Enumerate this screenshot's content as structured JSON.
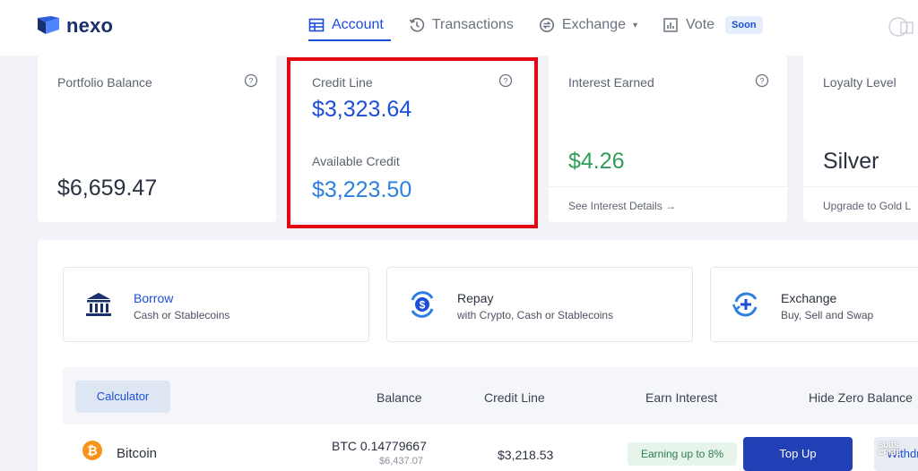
{
  "brand": {
    "name": "nexo"
  },
  "nav": {
    "items": [
      {
        "label": "Account",
        "icon": "table-icon",
        "active": true
      },
      {
        "label": "Transactions",
        "icon": "history-icon",
        "active": false
      },
      {
        "label": "Exchange",
        "icon": "exchange-icon",
        "active": false,
        "dropdown": true
      },
      {
        "label": "Vote",
        "icon": "chart-icon",
        "active": false,
        "badge": "Soon"
      }
    ],
    "gift_icon": "gift-icon"
  },
  "stats": {
    "portfolio": {
      "label": "Portfolio Balance",
      "value": "$6,659.47"
    },
    "credit": {
      "label": "Credit Line",
      "value": "$3,323.64",
      "available_label": "Available Credit",
      "available_value": "$3,223.50"
    },
    "interest": {
      "label": "Interest Earned",
      "value": "$4.26",
      "link": "See Interest Details →"
    },
    "loyalty": {
      "label": "Loyalty Level",
      "value": "Silver",
      "link": "Upgrade to Gold L"
    }
  },
  "actions": [
    {
      "title": "Borrow",
      "subtitle": "Cash or Stablecoins",
      "icon": "bank-icon"
    },
    {
      "title": "Repay",
      "subtitle": "with Crypto, Cash or Stablecoins",
      "icon": "repay-icon"
    },
    {
      "title": "Exchange",
      "subtitle": "Buy, Sell and Swap",
      "icon": "swap-icon"
    }
  ],
  "table": {
    "calculator_label": "Calculator",
    "columns": [
      "Balance",
      "Credit Line",
      "Earn Interest",
      "Hide Zero Balance"
    ],
    "rows": [
      {
        "coin": "Bitcoin",
        "balance": "BTC 0.14779667",
        "balance_fiat": "$6,437.07",
        "credit_line": "$3,218.53",
        "earn": "Earning up to 8%",
        "top_up": "Top Up",
        "withdraw": "Withdr"
      }
    ]
  },
  "watermark": {
    "line1": "SUBS",
    "line2": "CRIBE"
  },
  "colors": {
    "accent": "#1d4ed8",
    "green": "#2f9e5a",
    "highlight": "#e30613",
    "button": "#2140b5"
  }
}
